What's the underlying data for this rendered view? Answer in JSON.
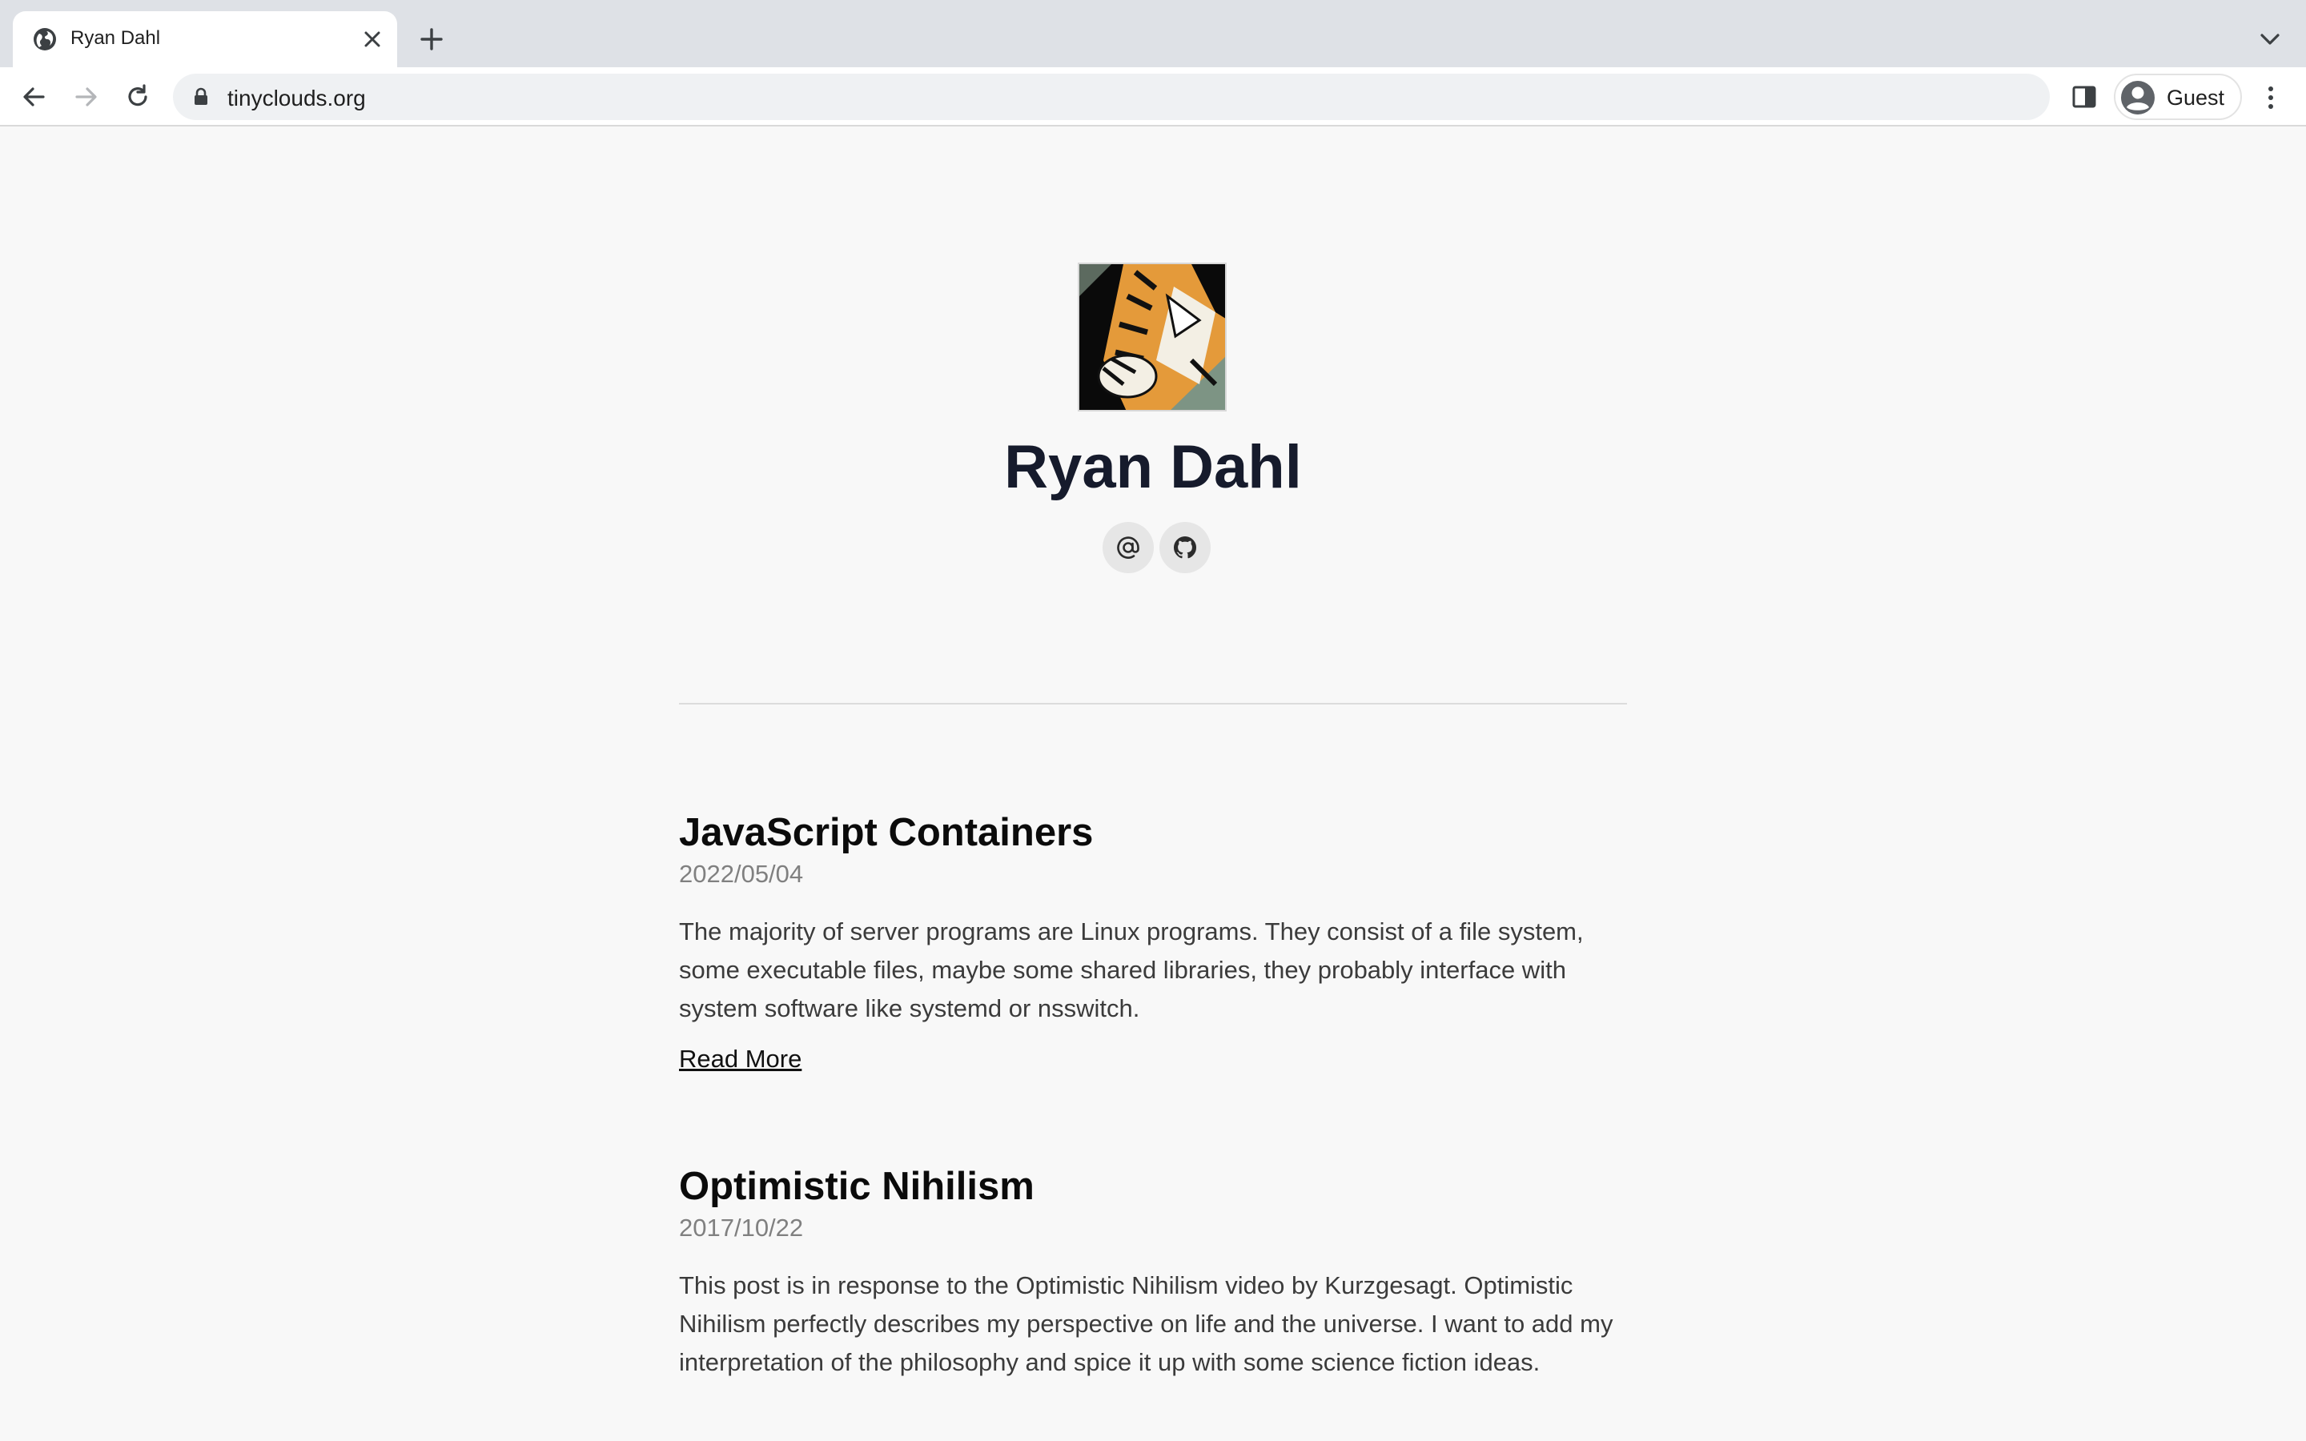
{
  "browser": {
    "tab_title": "Ryan Dahl",
    "url": "tinyclouds.org",
    "profile_label": "Guest"
  },
  "site": {
    "author_name": "Ryan Dahl",
    "social_icons": [
      "email-icon",
      "github-icon"
    ]
  },
  "posts": [
    {
      "title": "JavaScript Containers",
      "date": "2022/05/04",
      "excerpt": "The majority of server programs are Linux programs. They consist of a file system, some executable files, maybe some shared libraries, they probably interface with system software like systemd or nsswitch.",
      "link_label": "Read More"
    },
    {
      "title": "Optimistic Nihilism",
      "date": "2017/10/22",
      "excerpt": "This post is in response to the Optimistic Nihilism video by Kurzgesagt. Optimistic Nihilism perfectly describes my perspective on life and the universe. I want to add my interpretation of the philosophy and spice it up with some science fiction ideas."
    }
  ],
  "colors": {
    "page_background": "#f8f8f8",
    "title_color": "#161b2c",
    "date_color": "#808080"
  }
}
